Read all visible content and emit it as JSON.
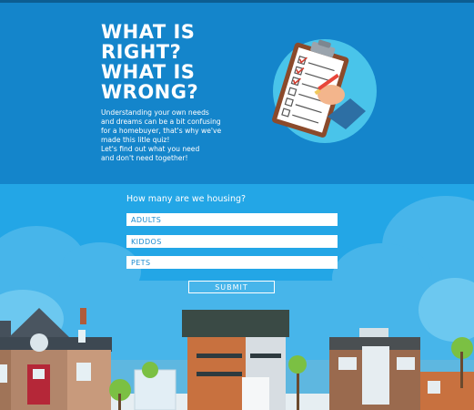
{
  "hero": {
    "title_lines": [
      "WHAT IS",
      "RIGHT?",
      "WHAT IS",
      "WRONG?"
    ],
    "intro_lines": [
      "Understanding your own needs",
      "and dreams can be a bit confusing",
      "for a homebuyer, that's why we've",
      "made this litle quiz!",
      "Let's find out what you need",
      "and don't need together!"
    ],
    "illustration_icon": "clipboard-checklist-icon"
  },
  "quiz": {
    "question": "How many are we housing?",
    "fields": {
      "adults_placeholder": "ADULTS",
      "kiddos_placeholder": "KIDDOS",
      "pets_placeholder": "PETS"
    },
    "submit_label": "SUBMIT"
  },
  "colors": {
    "hero_bg": "#1485cb",
    "quiz_bg": "#23a6e6",
    "field_text": "#1a8bd0",
    "ground": "#5eb7e0"
  }
}
